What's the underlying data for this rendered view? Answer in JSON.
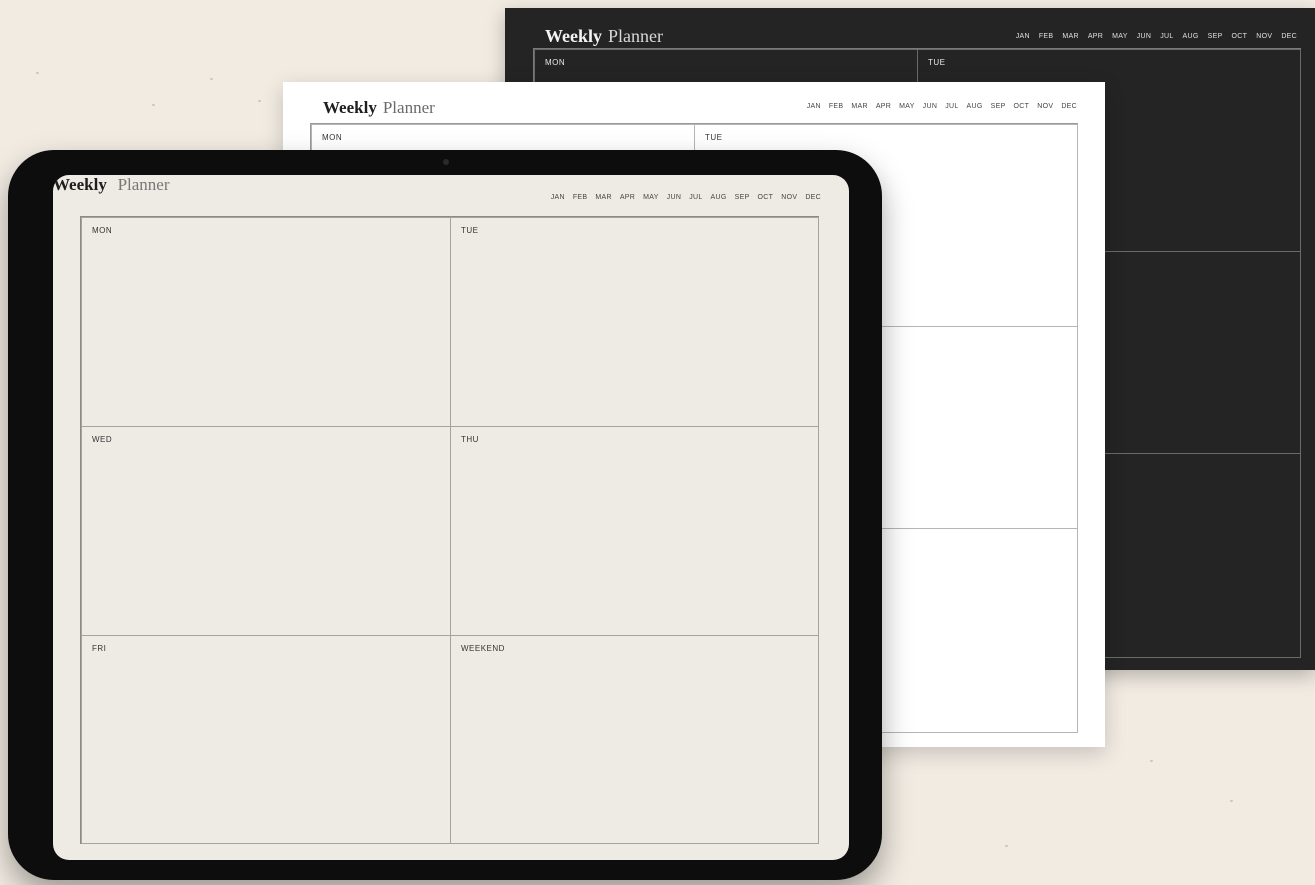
{
  "planner": {
    "title_bold": "Weekly",
    "title_light": "Planner",
    "months": [
      "JAN",
      "FEB",
      "MAR",
      "APR",
      "MAY",
      "JUN",
      "JUL",
      "AUG",
      "SEP",
      "OCT",
      "NOV",
      "DEC"
    ],
    "days": [
      "MON",
      "TUE",
      "WED",
      "THU",
      "FRI",
      "WEEKEND"
    ]
  },
  "colors": {
    "background": "#f1ebe2",
    "dark_sheet": "#242424",
    "white_sheet": "#ffffff",
    "tablet_screen": "#eeebe5",
    "tablet_bezel": "#0d0d0d"
  }
}
